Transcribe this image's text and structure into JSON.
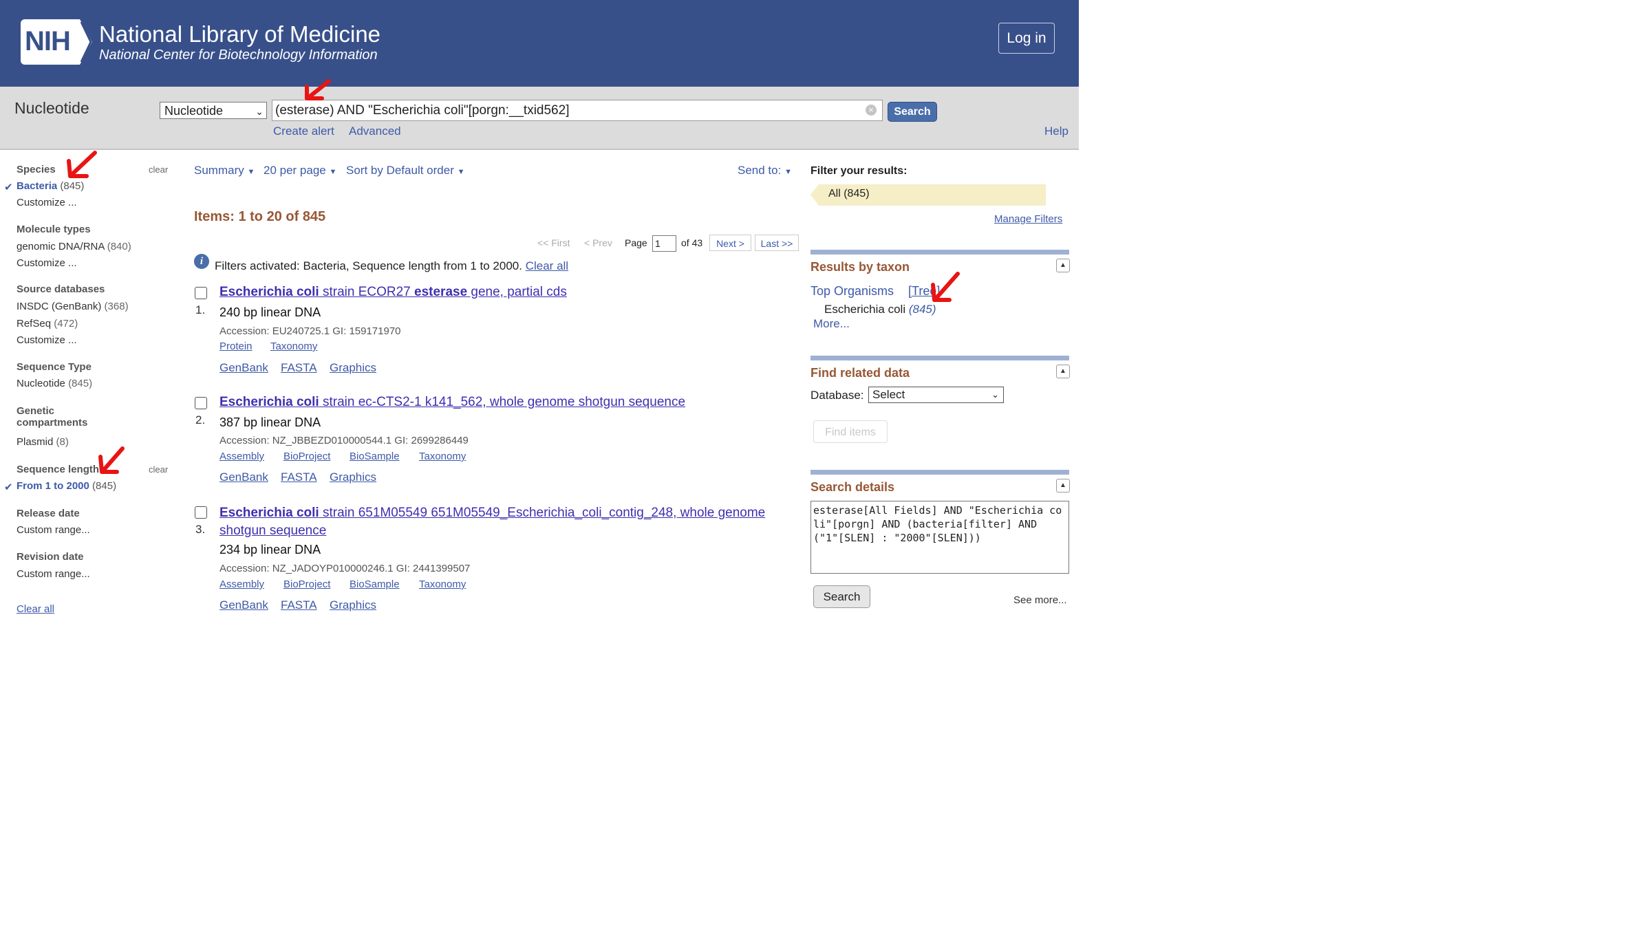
{
  "header": {
    "logo": "NIH",
    "org_name": "National Library of Medicine",
    "org_subtitle": "National Center for Biotechnology Information",
    "login": "Log in"
  },
  "search": {
    "db_title": "Nucleotide",
    "db_select": "Nucleotide",
    "query": "(esterase) AND \"Escherichia coli\"[porgn:__txid562]",
    "search_button": "Search",
    "create_alert": "Create alert",
    "advanced": "Advanced",
    "help": "Help"
  },
  "filters": {
    "clear": "clear",
    "species_head": "Species",
    "species_selected": "Bacteria",
    "species_selected_count": "(845)",
    "customize": "Customize ...",
    "molecule_head": "Molecule types",
    "molecule_item": "genomic DNA/RNA",
    "molecule_count": "(840)",
    "source_head": "Source databases",
    "source_items": [
      {
        "label": "INSDC (GenBank)",
        "count": "(368)"
      },
      {
        "label": "RefSeq",
        "count": "(472)"
      }
    ],
    "seqtype_head": "Sequence Type",
    "seqtype_item": "Nucleotide",
    "seqtype_count": "(845)",
    "genetic_head_1": "Genetic",
    "genetic_head_2": "compartments",
    "genetic_item": "Plasmid",
    "genetic_count": "(8)",
    "seqlen_head": "Sequence length",
    "seqlen_selected": "From 1 to 2000",
    "seqlen_count": "(845)",
    "release_head": "Release date",
    "release_item": "Custom range...",
    "revision_head": "Revision date",
    "revision_item": "Custom range...",
    "clear_all": "Clear all"
  },
  "toolbar": {
    "summary": "Summary",
    "per_page": "20 per page",
    "sort": "Sort by Default order",
    "send_to": "Send to:",
    "dropdown_glyph": "▼"
  },
  "results": {
    "items_label": "Items: 1 to 20 of 845",
    "pager": {
      "first": "<< First",
      "prev": "< Prev",
      "page_label": "Page",
      "page_value": "1",
      "of_label": "of 43",
      "next": "Next >",
      "last": "Last >>"
    },
    "filters_msg": "Filters activated: Bacteria, Sequence length from 1 to 2000.",
    "clear_all": "Clear all",
    "list": [
      {
        "num": "1.",
        "title_organism": "Escherichia coli",
        "title_mid": " strain ECOR27 ",
        "title_bold2": "esterase",
        "title_rest": " gene, partial cds",
        "desc": "240 bp linear DNA",
        "accession": "Accession: EU240725.1    GI: 159171970",
        "links_small": [
          "Protein",
          "Taxonomy"
        ],
        "links": [
          "GenBank",
          "FASTA",
          "Graphics"
        ]
      },
      {
        "num": "2.",
        "title_organism": "Escherichia coli",
        "title_rest": " strain ec-CTS2-1 k141_562, whole genome shotgun sequence",
        "desc": "387 bp linear DNA",
        "accession": "Accession: NZ_JBBEZD010000544.1    GI: 2699286449",
        "links_small": [
          "Assembly",
          "BioProject",
          "BioSample",
          "Taxonomy"
        ],
        "links": [
          "GenBank",
          "FASTA",
          "Graphics"
        ]
      },
      {
        "num": "3.",
        "title_organism": "Escherichia coli",
        "title_rest": " strain 651M05549 651M05549_Escherichia_coli_contig_248, whole genome",
        "title_line2": "shotgun sequence",
        "desc": "234 bp linear DNA",
        "accession": "Accession: NZ_JADOYP010000246.1    GI: 2441399507",
        "links_small": [
          "Assembly",
          "BioProject",
          "BioSample",
          "Taxonomy"
        ],
        "links": [
          "GenBank",
          "FASTA",
          "Graphics"
        ]
      }
    ]
  },
  "right": {
    "filter_header": "Filter your results:",
    "all_filter": "All (845)",
    "manage_filters": "Manage Filters",
    "taxon_head": "Results by taxon",
    "top_organisms": "Top Organisms",
    "tree": "[Tree]",
    "organism": "Escherichia coli",
    "organism_count": "(845)",
    "more": "More...",
    "related_head": "Find related data",
    "database_label": "Database:",
    "database_value": "Select",
    "find_items": "Find items",
    "details_head": "Search details",
    "details_text": "esterase[All Fields] AND \"Escherichia coli\"[porgn] AND (bacteria[filter] AND (\"1\"[SLEN] : \"2000\"[SLEN]))",
    "search_button": "Search",
    "see_more": "See more...",
    "toggle_glyph": "▲"
  },
  "colors": {
    "header_bg": "#38508a",
    "search_bar_bg": "#dcdcdc",
    "link": "#3e5aa8",
    "heading_brown": "#985735",
    "annotation_red": "#e81414"
  }
}
